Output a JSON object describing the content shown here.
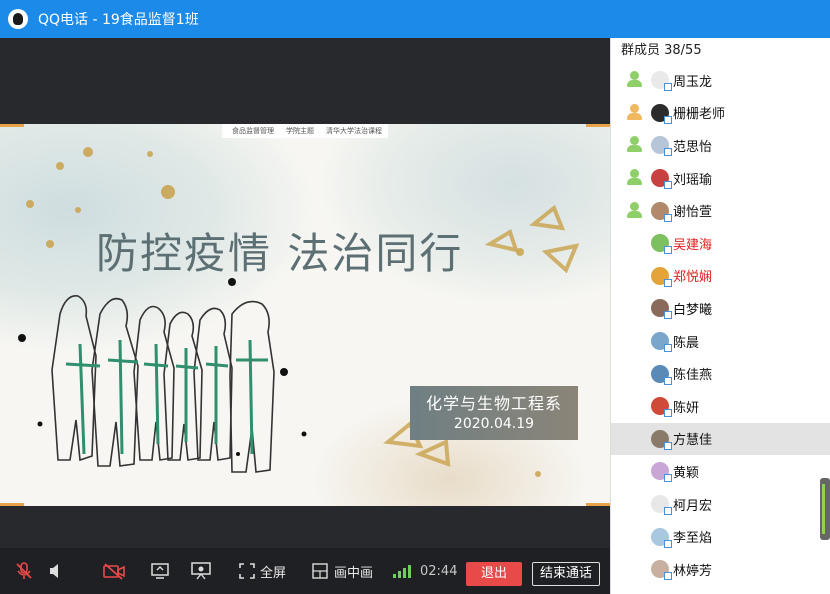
{
  "window": {
    "title": "QQ电话 - 19食品监督1班"
  },
  "slide": {
    "topbar": [
      "食品监督管理",
      "学院主题",
      "清华大学法治课程"
    ],
    "headline": "防控疫情 法治同行",
    "department": "化学与生物工程系",
    "date": "2020.04.19"
  },
  "sidebar": {
    "members_label": "群成员 38/55",
    "members": [
      {
        "name": "周玉龙",
        "mic": "green",
        "avatar": "#e9e9e9",
        "red": false
      },
      {
        "name": "栅栅老师",
        "mic": "orange",
        "avatar": "#2c2c2c",
        "red": false
      },
      {
        "name": "范思怡",
        "mic": "green",
        "avatar": "#b6c6d8",
        "red": false
      },
      {
        "name": "刘瑶瑜",
        "mic": "green",
        "avatar": "#c84040",
        "red": false
      },
      {
        "name": "谢怡萱",
        "mic": "green",
        "avatar": "#b08a6a",
        "red": false
      },
      {
        "name": "吴建海",
        "mic": "none",
        "avatar": "#7cc060",
        "red": true
      },
      {
        "name": "郑悦娴",
        "mic": "none",
        "avatar": "#e5a43a",
        "red": true
      },
      {
        "name": "白梦曦",
        "mic": "none",
        "avatar": "#8a6a5a",
        "red": false
      },
      {
        "name": "陈晨",
        "mic": "none",
        "avatar": "#7aa6cc",
        "red": false
      },
      {
        "name": "陈佳燕",
        "mic": "none",
        "avatar": "#5a8ab6",
        "red": false
      },
      {
        "name": "陈妍",
        "mic": "none",
        "avatar": "#d04a3a",
        "red": false
      },
      {
        "name": "方慧佳",
        "mic": "none",
        "avatar": "#8a7a6a",
        "red": false,
        "selected": true
      },
      {
        "name": "黄颖",
        "mic": "none",
        "avatar": "#c8a6d6",
        "red": false
      },
      {
        "name": "柯月宏",
        "mic": "none",
        "avatar": "#e8e8e8",
        "red": false
      },
      {
        "name": "李至焰",
        "mic": "none",
        "avatar": "#a8c8e0",
        "red": false
      },
      {
        "name": "林婷芳",
        "mic": "none",
        "avatar": "#c8b0a0",
        "red": false
      }
    ]
  },
  "toolbar": {
    "fullscreen_label": "全屏",
    "pip_label": "画中画",
    "timer": "02:44",
    "exit_label": "退出",
    "end_call_label": "结束通话"
  }
}
